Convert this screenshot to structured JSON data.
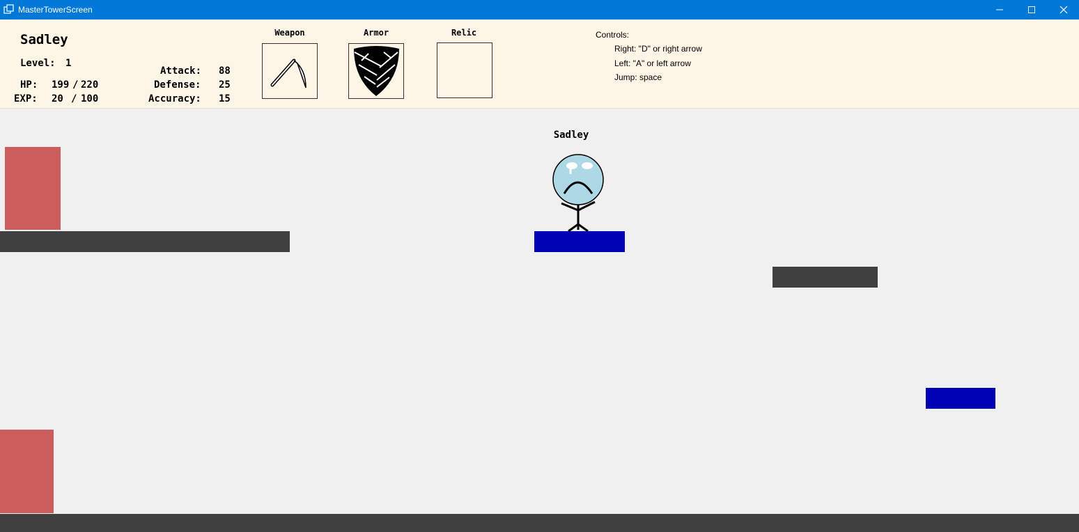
{
  "window": {
    "title": "MasterTowerScreen",
    "accent": "#0078d7"
  },
  "hud": {
    "name": "Sadley",
    "level_label": "Level:",
    "level_value": "1",
    "hp_label": "HP:",
    "hp_current": "199",
    "hp_sep": "/",
    "hp_max": "220",
    "exp_label": "EXP:",
    "exp_current": "20",
    "exp_sep": "/",
    "exp_max": "100",
    "attack_label": "Attack:",
    "attack_value": "88",
    "defense_label": "Defense:",
    "defense_value": "25",
    "accuracy_label": "Accuracy:",
    "accuracy_value": "15",
    "background": "#fdf5e6"
  },
  "equipment": {
    "weapon_label": "Weapon",
    "weapon_icon": "scythe-icon",
    "armor_label": "Armor",
    "armor_icon": "shield-icon",
    "relic_label": "Relic"
  },
  "controls": {
    "heading": "Controls:",
    "right": "Right: \"D\" or right arrow",
    "left": "Left: \"A\" or left arrow",
    "jump": "Jump: space"
  },
  "scene": {
    "player_name": "Sadley",
    "colors": {
      "background": "#f0f0f0",
      "platform_dark": "#404040",
      "platform_blue": "#0000b4",
      "block_red": "#cd5c5c",
      "player_face": "#add8e6"
    }
  }
}
